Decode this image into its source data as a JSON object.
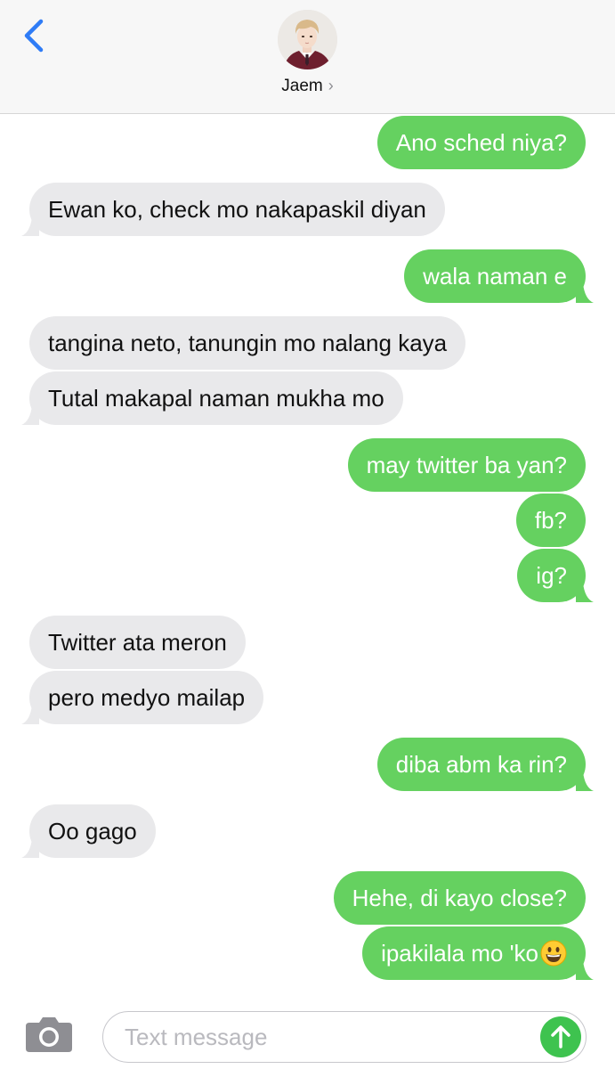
{
  "header": {
    "contact_name": "Jaem",
    "chevron": "›"
  },
  "messages": [
    {
      "direction": "outgoing",
      "text": "Ano sched niya?"
    },
    {
      "direction": "incoming",
      "text": "Ewan ko, check mo nakapaskil diyan"
    },
    {
      "direction": "outgoing",
      "text": "wala naman e"
    },
    {
      "direction": "incoming",
      "text": "tangina neto, tanungin mo nalang kaya"
    },
    {
      "direction": "incoming",
      "text": "Tutal makapal naman mukha mo"
    },
    {
      "direction": "outgoing",
      "text": "may twitter ba yan?"
    },
    {
      "direction": "outgoing",
      "text": "fb?"
    },
    {
      "direction": "outgoing",
      "text": "ig?"
    },
    {
      "direction": "incoming",
      "text": "Twitter ata meron"
    },
    {
      "direction": "incoming",
      "text": "pero medyo mailap"
    },
    {
      "direction": "outgoing",
      "text": "diba abm ka rin?"
    },
    {
      "direction": "incoming",
      "text": "Oo gago"
    },
    {
      "direction": "outgoing",
      "text": "Hehe, di kayo close?"
    },
    {
      "direction": "outgoing",
      "text": "ipakilala mo 'ko",
      "emoji": "grinning-face-emoji"
    }
  ],
  "composer": {
    "placeholder": "Text message"
  },
  "colors": {
    "outgoing_bubble": "#65d160",
    "incoming_bubble": "#e9e9eb",
    "accent_blue": "#2f7cf6",
    "send_button": "#3ec34f"
  },
  "icons": [
    "back-icon",
    "camera-icon",
    "send-arrow-icon",
    "grinning-face-emoji"
  ]
}
